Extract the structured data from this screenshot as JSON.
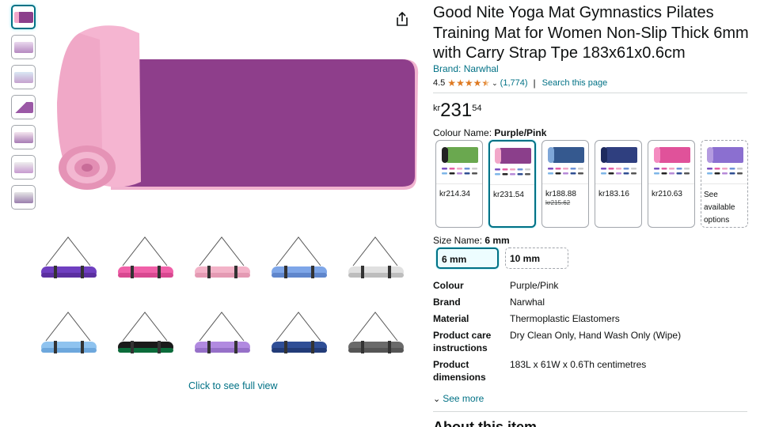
{
  "product": {
    "title": "Good Nite Yoga Mat Gymnastics Pilates Training Mat for Women Non-Slip Thick 6mm with Carry Strap Tpe 183x61x0.6cm",
    "brand_link": "Brand: Narwhal",
    "rating_value": "4.5",
    "rating_count": "(1,774)",
    "separator": "|",
    "search_page": "Search this page",
    "price_currency": "kr",
    "price_whole": "231",
    "price_fraction": "54"
  },
  "colour": {
    "label": "Colour Name: ",
    "selected": "Purple/Pink",
    "options": [
      {
        "price": "kr214.34",
        "strike": "",
        "color": "#6aa84f"
      },
      {
        "price": "kr231.54",
        "strike": "",
        "color": "#8b3f8b"
      },
      {
        "price": "kr188.88",
        "strike": "kr215.62",
        "color": "#35598f"
      },
      {
        "price": "kr183.16",
        "strike": "",
        "color": "#2f3f7f"
      },
      {
        "price": "kr210.63",
        "strike": "",
        "color": "#e0529a"
      },
      {
        "text": "See available options",
        "color": "#8b6fd0"
      }
    ]
  },
  "size": {
    "label": "Size Name: ",
    "selected": "6 mm",
    "options": [
      "6 mm",
      "10 mm"
    ]
  },
  "specs": [
    {
      "key": "Colour",
      "value": "Purple/Pink"
    },
    {
      "key": "Brand",
      "value": "Narwhal"
    },
    {
      "key": "Material",
      "value": "Thermoplastic Elastomers"
    },
    {
      "key": "Product care instructions",
      "value": "Dry Clean Only, Hand Wash Only (Wipe)"
    },
    {
      "key": "Product dimensions",
      "value": "183L x 61W x 0.6Th centimetres"
    }
  ],
  "see_more": "See more",
  "about_heading": "About this item",
  "gallery": {
    "click_full": "Click to see full view"
  },
  "colors": {
    "link": "#007185",
    "star": "#de7921",
    "selected_border": "#007185"
  }
}
